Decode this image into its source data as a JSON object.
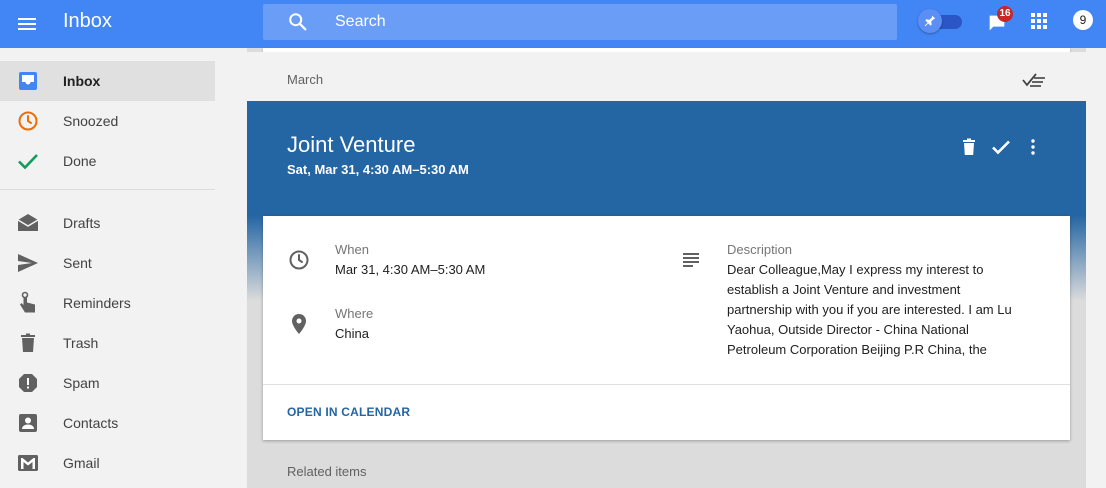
{
  "app": {
    "title": "Inbox"
  },
  "search": {
    "placeholder": "Search"
  },
  "header": {
    "notifications_count": "16",
    "avatar_initial": "9"
  },
  "sidebar": {
    "items": [
      {
        "label": "Inbox",
        "icon": "inbox-icon",
        "color": "#4285f4",
        "active": true
      },
      {
        "label": "Snoozed",
        "icon": "clock-icon",
        "color": "#ef6c00"
      },
      {
        "label": "Done",
        "icon": "check-icon",
        "color": "#0f9d58"
      },
      {
        "label": "Drafts",
        "icon": "drafts-icon"
      },
      {
        "label": "Sent",
        "icon": "send-icon"
      },
      {
        "label": "Reminders",
        "icon": "reminder-hand-icon"
      },
      {
        "label": "Trash",
        "icon": "trash-icon"
      },
      {
        "label": "Spam",
        "icon": "spam-icon"
      },
      {
        "label": "Contacts",
        "icon": "contacts-icon"
      },
      {
        "label": "Gmail",
        "icon": "gmail-icon"
      }
    ]
  },
  "main": {
    "month_label": "March",
    "event": {
      "title": "Joint Venture",
      "subtitle": "Sat, Mar 31, 4:30 AM–5:30 AM",
      "when_label": "When",
      "when_value": "Mar 31, 4:30 AM–5:30 AM",
      "where_label": "Where",
      "where_value": "China",
      "description_label": "Description",
      "description_value": "Dear Colleague,May I express my interest to establish a Joint Venture and investment partnership with you if you are interested. I am Lu Yaohua, Outside Director - China National Petroleum Corporation Beijing P.R China, the",
      "open_calendar_label": "OPEN IN CALENDAR"
    },
    "related_label": "Related items"
  },
  "colors": {
    "topbar": "#4285f4",
    "event_header": "#2465a3",
    "badge": "#c62828"
  }
}
